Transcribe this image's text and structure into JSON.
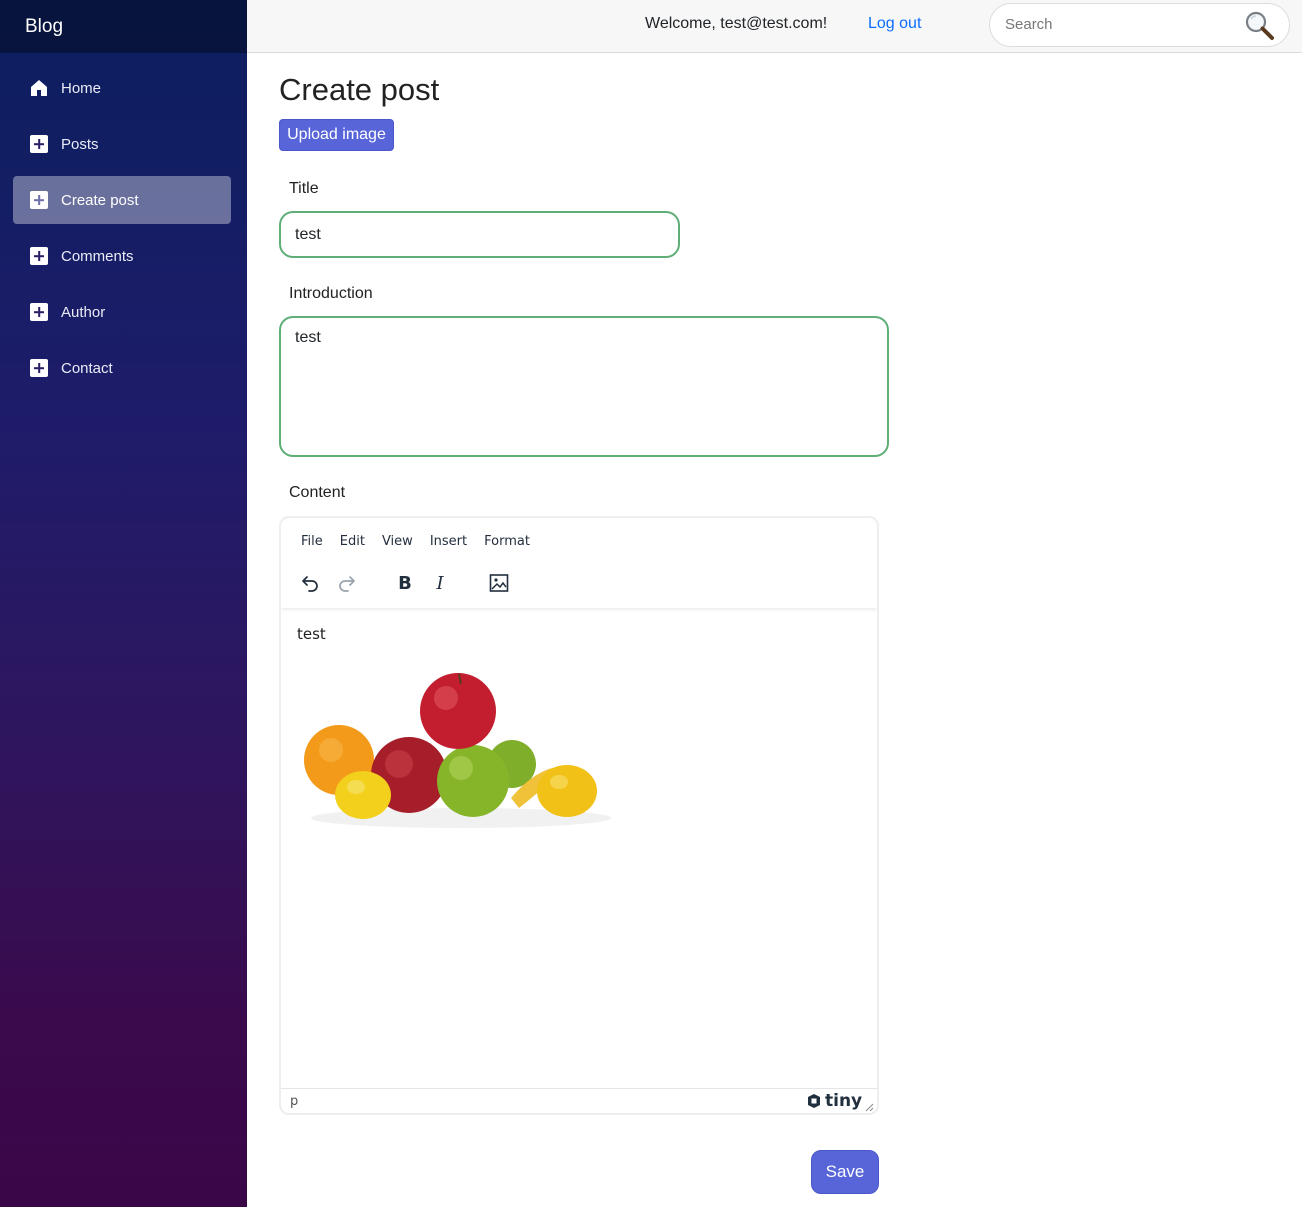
{
  "app": {
    "brand": "Blog"
  },
  "sidebar": {
    "items": [
      {
        "label": "Home",
        "icon": "home-icon",
        "active": false
      },
      {
        "label": "Posts",
        "icon": "plus-square-icon",
        "active": false
      },
      {
        "label": "Create post",
        "icon": "plus-square-icon",
        "active": true
      },
      {
        "label": "Comments",
        "icon": "plus-square-icon",
        "active": false
      },
      {
        "label": "Author",
        "icon": "plus-square-icon",
        "active": false
      },
      {
        "label": "Contact",
        "icon": "plus-square-icon",
        "active": false
      }
    ]
  },
  "header": {
    "welcome": "Welcome, test@test.com!",
    "logout": "Log out",
    "search": {
      "placeholder": "Search",
      "value": "",
      "icon": "magnifier-icon"
    }
  },
  "main": {
    "title": "Create post",
    "upload_button": "Upload image",
    "fields": {
      "title": {
        "label": "Title",
        "value": "test"
      },
      "introduction": {
        "label": "Introduction",
        "value": "test"
      },
      "content": {
        "label": "Content"
      }
    },
    "save_button": "Save"
  },
  "editor": {
    "menus": [
      "File",
      "Edit",
      "View",
      "Insert",
      "Format"
    ],
    "toolbar": [
      "undo-icon",
      "redo-icon",
      "bold-icon",
      "italic-icon",
      "image-icon"
    ],
    "body_text": "test",
    "image": "fruit-image",
    "path": "p",
    "brand": "tiny"
  },
  "colors": {
    "accent": "#5765d8",
    "field_border": "#5fae78",
    "link": "#0d6efd",
    "sidebar_top": "#0b1f5e",
    "sidebar_bottom": "#3b0648"
  }
}
